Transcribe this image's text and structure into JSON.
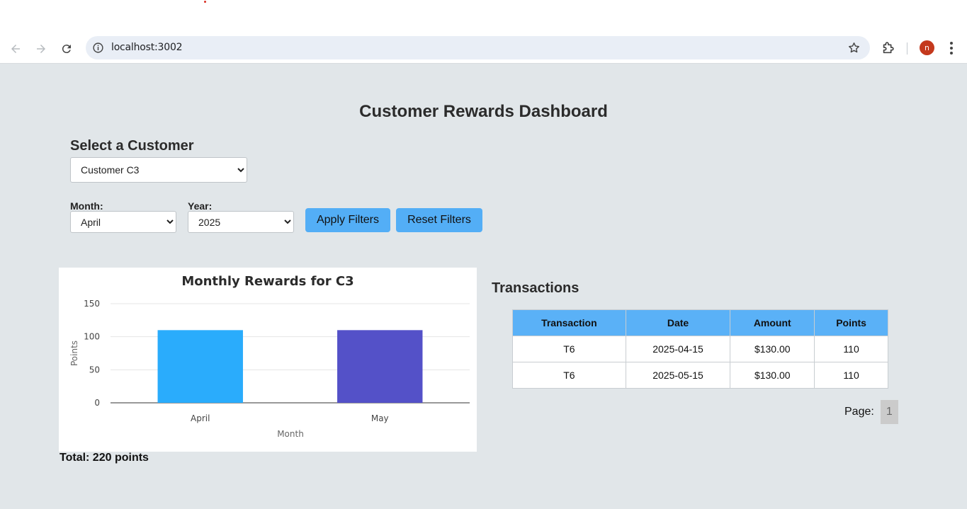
{
  "browser": {
    "url": "localhost:3002",
    "profile_initial": "n"
  },
  "page": {
    "title": "Customer Rewards Dashboard",
    "customer_section_title": "Select a Customer",
    "selected_customer": "Customer C3",
    "month_label": "Month:",
    "selected_month": "April",
    "year_label": "Year:",
    "selected_year": "2025",
    "apply_label": "Apply Filters",
    "reset_label": "Reset Filters",
    "total_text": "Total: 220 points"
  },
  "chart_data": {
    "type": "bar",
    "title": "Monthly Rewards for C3",
    "categories": [
      "April",
      "May"
    ],
    "values": [
      110,
      110
    ],
    "bar_colors": [
      "#2aacfc",
      "#5451c8"
    ],
    "xlabel": "Month",
    "ylabel": "Points",
    "ylim": [
      0,
      150
    ],
    "yticks": [
      0,
      50,
      100,
      150
    ],
    "grid": true,
    "legend": "none"
  },
  "transactions": {
    "title": "Transactions",
    "columns": [
      "Transaction",
      "Date",
      "Amount",
      "Points"
    ],
    "rows": [
      [
        "T6",
        "2025-04-15",
        "$130.00",
        "110"
      ],
      [
        "T6",
        "2025-05-15",
        "$130.00",
        "110"
      ]
    ],
    "page_label": "Page:",
    "pages": [
      "1"
    ]
  }
}
